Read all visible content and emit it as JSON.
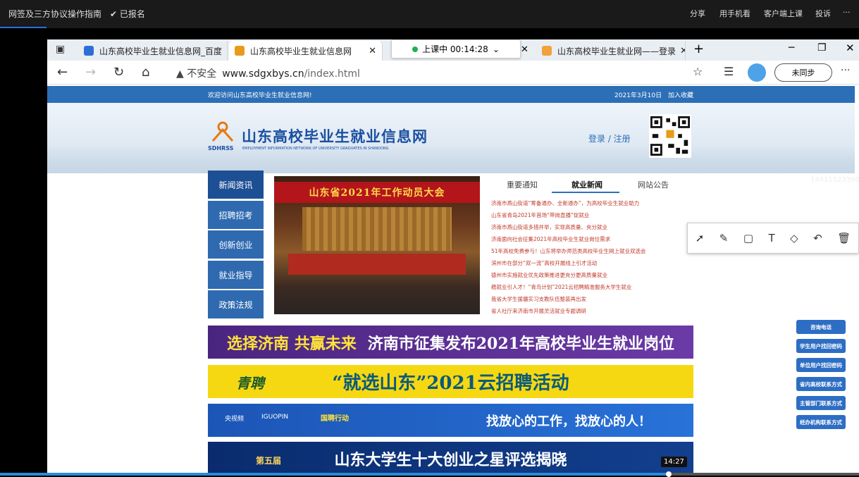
{
  "player": {
    "title": "网签及三方协议操作指南",
    "registered": "✔ 已报名",
    "actions": [
      "分享",
      "用手机看",
      "客户端上课",
      "投诉",
      "···"
    ],
    "time": "14:27",
    "progress": 0.78
  },
  "browser": {
    "tabs": [
      {
        "label": "山东高校毕业生就业信息网_百度",
        "fav_color": "#2d6fd6"
      },
      {
        "label": "山东高校毕业生就业信息网",
        "fav_color": "#e89a1a"
      },
      {
        "label": "山东高校毕业生就业网——登录",
        "fav_color": "#f2a23a"
      }
    ],
    "recording": "上课中 00:14:28",
    "recording_caret": "⌄",
    "url_insecure": "▲ 不安全",
    "url_domain": "www.sdgxbys.cn",
    "url_path": "/index.html",
    "sync_label": "未同步"
  },
  "site": {
    "welcome": "欢迎访问山东高校毕业生就业信息网!",
    "date": "2021年3月10日",
    "fav": "加入收藏",
    "logo_cn": "山东高校毕业生就业信息网",
    "logo_abbr": "SDHRSS",
    "logo_en": "EMPLOYMENT INFORMATION NETWORK OF UNIVERSITY GRADUATES IN SHANDONG",
    "login": "登录 / 注册",
    "side_number": "14411523390",
    "left_nav": [
      "新闻资讯",
      "招聘招考",
      "创新创业",
      "就业指导",
      "政策法规"
    ],
    "photo_banner": "山东省2021年工作动员大会",
    "news_tabs": [
      "重要通知",
      "就业新闻",
      "网站公告"
    ],
    "news": [
      "济南市燕山街道“筹备通办、全新通办”，为高校毕业生就业助力",
      "山东省青岛2021年首场“带岗直播”促就业",
      "济南市燕山街道多措并举，实现高质量、充分就业",
      "济南面向社会征集2021年高校毕业生就业岗位需求",
      "51年高校免费参与！山东将举办师范类高校毕业生网上就业双选会",
      "滨州市在部分“双一流”高校开展线上引才活动",
      "德州市实施就业优先政策推进更充分更高质量就业",
      "稳就业引人才！“青鸟计划”2021云招聘精准服务大学生就业",
      "我省大学生援疆实习支教队伍整装再出发",
      "省人社厅来济南市开展灵活就业专题调研"
    ],
    "banner1_a": "选择济南 共赢未来",
    "banner1_b": "济南市征集发布2021年高校毕业生就业岗位",
    "banner2_q": "青聘",
    "banner2": "“就选山东”2021云招聘活动",
    "banner3_l": "央视频",
    "banner3_l2": "IGUOPIN",
    "banner3_l3": "国聘行动",
    "banner3": "找放心的工作，找放心的人！",
    "banner4_b": "第五届",
    "banner4": "山东大学生十大创业之星评选揭晓",
    "side_buttons": [
      "咨询电话",
      "学生用户找回密码",
      "单位用户找回密码",
      "省内高校联系方式",
      "主管部门联系方式",
      "经办机构联系方式"
    ]
  },
  "colors": {
    "site_blue": "#2c6fb7",
    "nav_blue": "#2f6ab0",
    "news_red": "#c0392b"
  }
}
